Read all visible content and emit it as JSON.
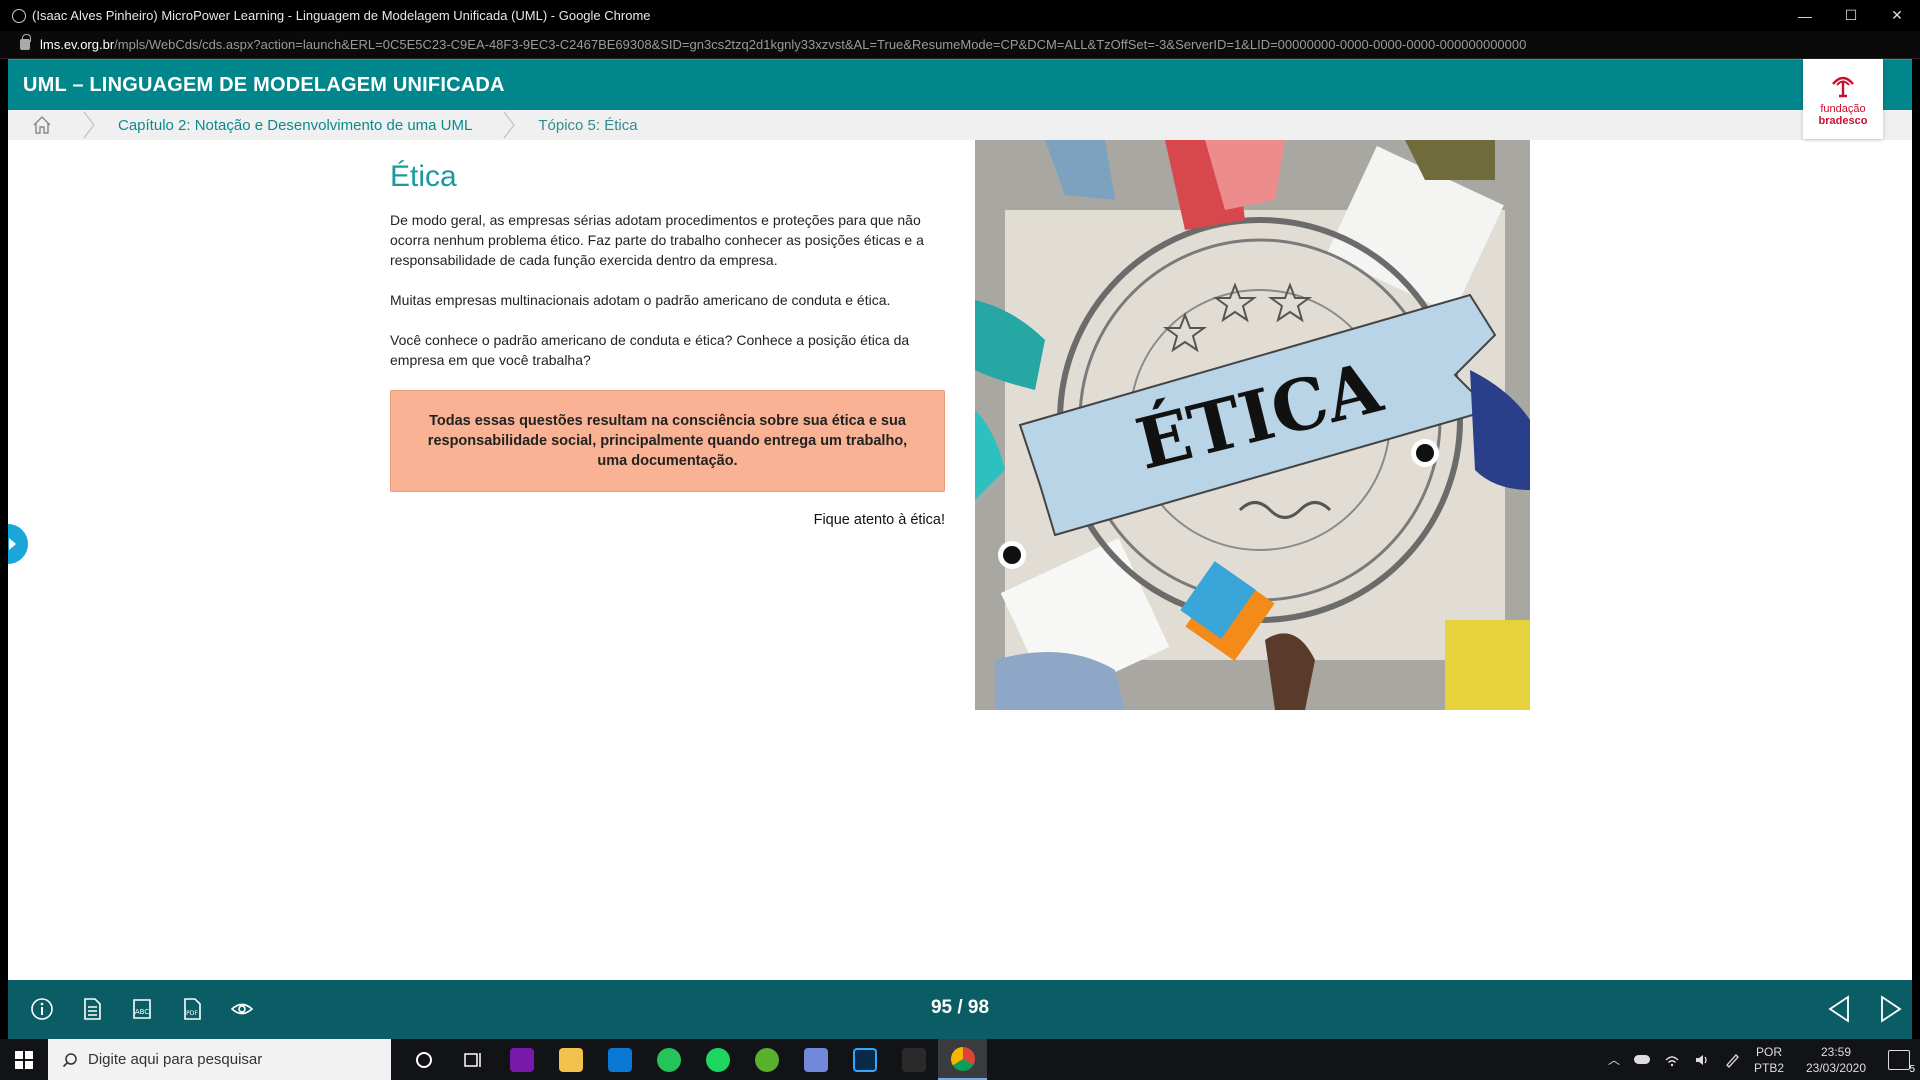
{
  "browser": {
    "title": "(Isaac Alves Pinheiro) MicroPower Learning - Linguagem de Modelagem Unificada (UML) - Google Chrome",
    "url_domain": "lms.ev.org.br",
    "url_path": "/mpls/WebCds/cds.aspx?action=launch&ERL=0C5E5C23-C9EA-48F3-9EC3-C2467BE69308&SID=gn3cs2tzq2d1kgnly33xzvst&AL=True&ResumeMode=CP&DCM=ALL&TzOffSet=-3&ServerID=1&LID=00000000-0000-0000-0000-000000000000",
    "minimize": "—",
    "maximize": "☐",
    "close": "✕"
  },
  "header": {
    "course_title": "UML – LINGUAGEM DE MODELAGEM UNIFICADA",
    "logo_line1": "fundação",
    "logo_line2": "bradesco"
  },
  "breadcrumb": {
    "chapter": "Capítulo 2: Notação e Desenvolvimento de uma UML",
    "topic": "Tópico 5: Ética"
  },
  "lesson": {
    "heading": "Ética",
    "paragraph1": "De modo geral, as empresas sérias adotam procedimentos e proteções para que não ocorra nenhum problema ético. Faz parte do trabalho conhecer as posições éticas e a responsabilidade de cada função exercida dentro da empresa.",
    "paragraph2": "Muitas empresas multinacionais adotam o padrão americano de conduta e ética.",
    "paragraph3": "Você conhece o padrão americano de conduta e ética? Conhece a posição ética da empresa em que você trabalha?",
    "callout": "Todas essas questões resultam na consciência sobre sua ética e sua responsabilidade social, principalmente quando entrega um trabalho, uma documentação.",
    "note": "Fique atento à ética!",
    "image_banner_text": "ÉTICA"
  },
  "footer": {
    "page_indicator": "95 / 98",
    "tools": [
      "info-icon",
      "document-icon",
      "abc-icon",
      "pdf-icon",
      "eye-icon"
    ],
    "tool_labels": {
      "abc": "ABC",
      "pdf": "PDF"
    }
  },
  "taskbar": {
    "search_placeholder": "Digite aqui para pesquisar",
    "lang_line1": "POR",
    "lang_line2": "PTB2",
    "time": "23:59",
    "date": "23/03/2020",
    "notifications": "5"
  }
}
